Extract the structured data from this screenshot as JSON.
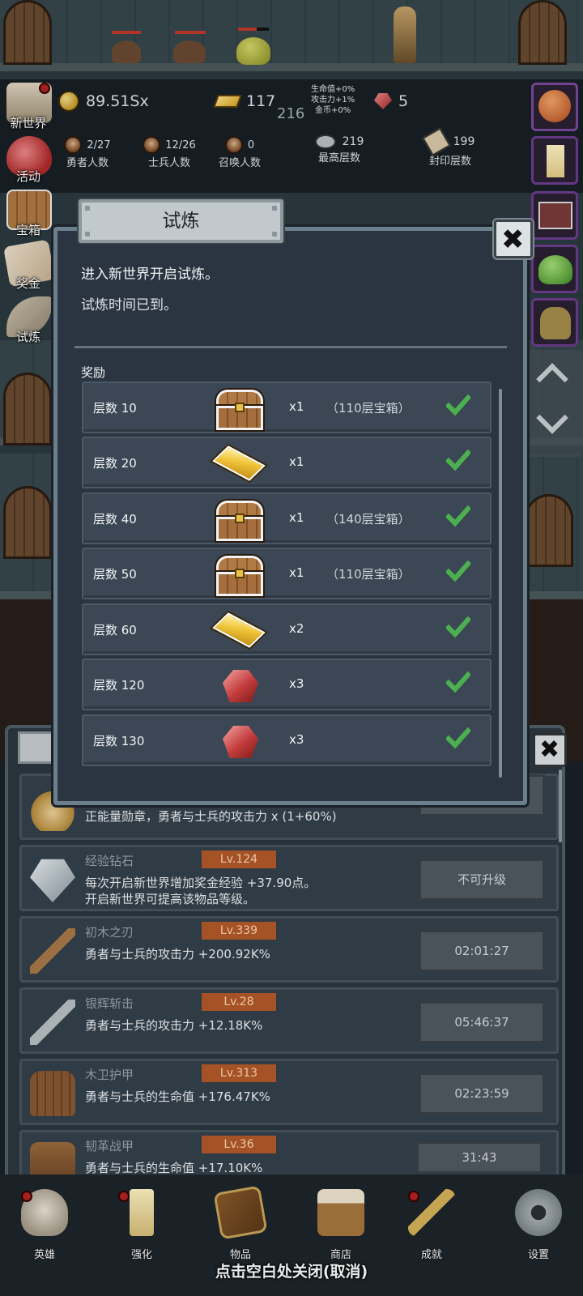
{
  "hud": {
    "gold": "89.51Sx",
    "bars": "117",
    "floor_sub": "216",
    "bonus_lines": [
      "生命值+0%",
      "攻击力+1%",
      "金币+0%"
    ],
    "gems": "5",
    "heroes_count": "2/27",
    "heroes_label": "勇者人数",
    "soldiers_count": "12/26",
    "soldiers_label": "士兵人数",
    "summon_count": "0",
    "summon_label": "召唤人数",
    "max_floor": "219",
    "max_floor_label": "最高层数",
    "seal_floor": "199",
    "seal_floor_label": "封印层数"
  },
  "sidebar_left": [
    {
      "label": "新世界",
      "icon": "new-world-icon",
      "dot": true
    },
    {
      "label": "活动",
      "icon": "heart-icon",
      "dot": false
    },
    {
      "label": "宝箱",
      "icon": "chest-icon",
      "dot": false
    },
    {
      "label": "奖金",
      "icon": "envelope-icon",
      "dot": false
    },
    {
      "label": "试炼",
      "icon": "feather-icon",
      "dot": false
    }
  ],
  "modal": {
    "title": "试炼",
    "text1": "进入新世界开启试炼。",
    "text2": "试炼时间已到。",
    "reward_header": "奖励",
    "rewards": [
      {
        "label": "层数 10",
        "item": "chest",
        "qty": "x1",
        "note": "（110层宝箱）",
        "claimed": true
      },
      {
        "label": "层数 20",
        "item": "gold-bar",
        "qty": "x1",
        "note": "",
        "claimed": true
      },
      {
        "label": "层数 40",
        "item": "chest",
        "qty": "x1",
        "note": "（140层宝箱）",
        "claimed": true
      },
      {
        "label": "层数 50",
        "item": "chest",
        "qty": "x1",
        "note": "（110层宝箱）",
        "claimed": true
      },
      {
        "label": "层数 60",
        "item": "gold-bar",
        "qty": "x2",
        "note": "",
        "claimed": true
      },
      {
        "label": "层数 120",
        "item": "gem",
        "qty": "x3",
        "note": "",
        "claimed": true
      },
      {
        "label": "层数 130",
        "item": "gem",
        "qty": "x3",
        "note": "",
        "claimed": true
      }
    ]
  },
  "upgrades": [
    {
      "name": "",
      "level": "",
      "desc": "正能量勋章，勇者与士兵的攻击力 x (1+60%)",
      "button": "不可升级",
      "icon": "medal-icon"
    },
    {
      "name": "经验钻石",
      "level": "Lv.124",
      "desc": "每次开启新世界增加奖金经验 +37.90点。\n开启新世界可提高该物品等级。",
      "button": "不可升级",
      "icon": "diamond-icon"
    },
    {
      "name": "初木之刃",
      "level": "Lv.339",
      "desc": "勇者与士兵的攻击力 +200.92K%",
      "button": "02:01:27",
      "icon": "wood-sword-icon"
    },
    {
      "name": "银辉斩击",
      "level": "Lv.28",
      "desc": "勇者与士兵的攻击力 +12.18K%",
      "button": "05:46:37",
      "icon": "silver-sword-icon"
    },
    {
      "name": "木卫护甲",
      "level": "Lv.313",
      "desc": "勇者与士兵的生命值 +176.47K%",
      "button": "02:23:59",
      "icon": "wood-armor-icon"
    },
    {
      "name": "韧革战甲",
      "level": "Lv.36",
      "desc": "勇者与士兵的生命值 +17.10K%",
      "button": "31:43",
      "icon": "leather-armor-icon"
    }
  ],
  "bottom_nav": [
    {
      "label": "英雄",
      "icon": "skull-icon",
      "dot": true
    },
    {
      "label": "强化",
      "icon": "candle-icon",
      "dot": true
    },
    {
      "label": "物品",
      "icon": "book-icon",
      "dot": false
    },
    {
      "label": "商店",
      "icon": "mug-icon",
      "dot": false
    },
    {
      "label": "成就",
      "icon": "key-icon",
      "dot": true
    },
    {
      "label": "设置",
      "icon": "gear-icon",
      "dot": false
    }
  ],
  "close_hint": "点击空白处关闭(取消)",
  "colors": {
    "modal_bg": "#2a3541",
    "row_bg": "#3b4754",
    "check_green": "#4caf50",
    "level_badge": "#b35a2a"
  }
}
